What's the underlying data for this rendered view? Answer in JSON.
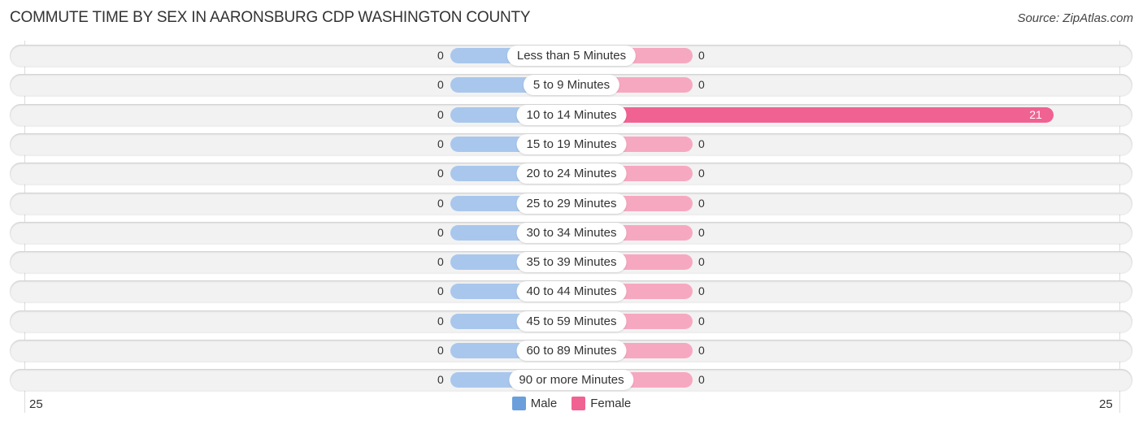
{
  "title": "COMMUTE TIME BY SEX IN AARONSBURG CDP WASHINGTON COUNTY",
  "source": "Source: ZipAtlas.com",
  "colors": {
    "male": "#a9c7ec",
    "female": "#f7a8c1",
    "female_highlight": "#f06292",
    "male_legend": "#6a9fdc",
    "female_legend": "#f06292"
  },
  "chart_data": {
    "type": "bar",
    "orientation": "horizontal-diverging",
    "title": "COMMUTE TIME BY SEX IN AARONSBURG CDP WASHINGTON COUNTY",
    "categories": [
      "Less than 5 Minutes",
      "5 to 9 Minutes",
      "10 to 14 Minutes",
      "15 to 19 Minutes",
      "20 to 24 Minutes",
      "25 to 29 Minutes",
      "30 to 34 Minutes",
      "35 to 39 Minutes",
      "40 to 44 Minutes",
      "45 to 59 Minutes",
      "60 to 89 Minutes",
      "90 or more Minutes"
    ],
    "series": [
      {
        "name": "Male",
        "values": [
          0,
          0,
          0,
          0,
          0,
          0,
          0,
          0,
          0,
          0,
          0,
          0
        ]
      },
      {
        "name": "Female",
        "values": [
          0,
          0,
          21,
          0,
          0,
          0,
          0,
          0,
          0,
          0,
          0,
          0
        ]
      }
    ],
    "xlim": [
      -25,
      25
    ],
    "tick_labels": {
      "left": "25",
      "right": "25"
    },
    "legend": {
      "position": "bottom-center",
      "entries": [
        "Male",
        "Female"
      ]
    },
    "grid": false
  }
}
